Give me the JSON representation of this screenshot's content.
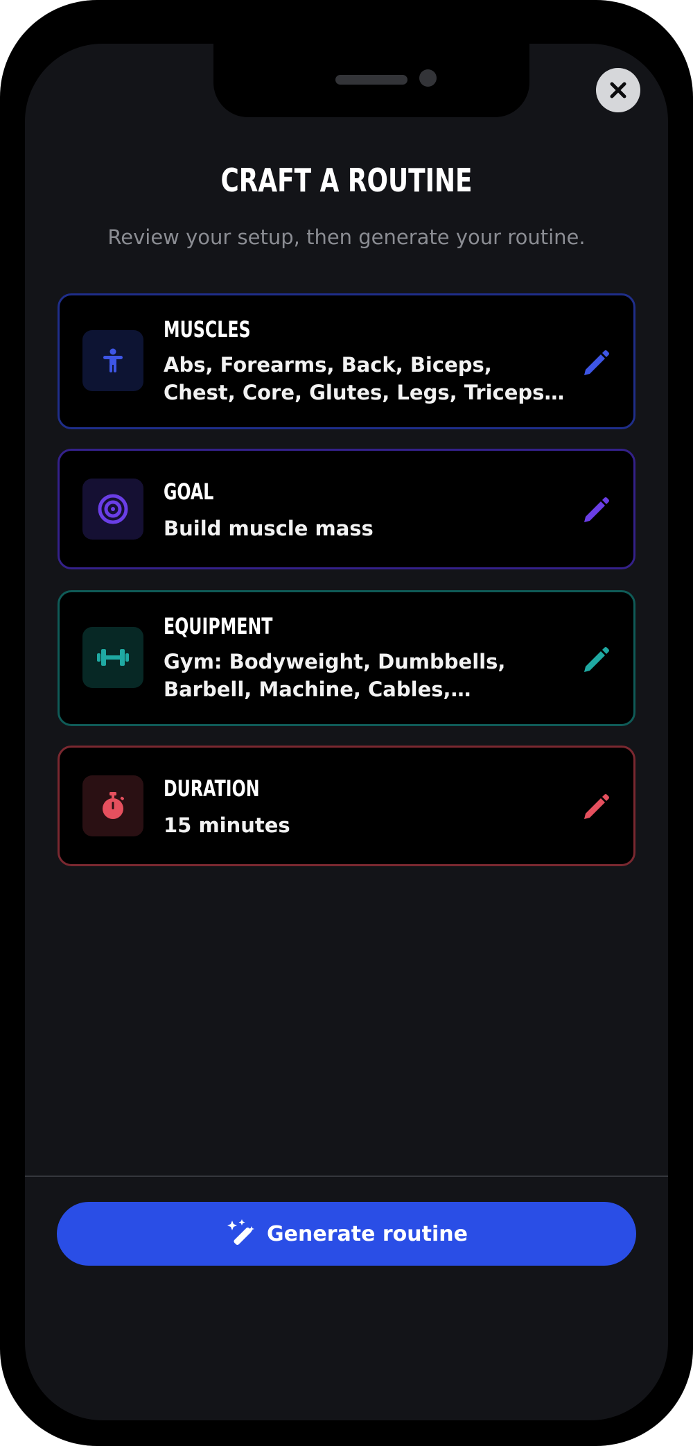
{
  "header": {
    "title": "CRAFT A ROUTINE",
    "subtitle": "Review your setup, then generate your routine."
  },
  "cards": [
    {
      "label": "MUSCLES",
      "value": "Abs, Forearms, Back, Biceps, Chest, Core, Glutes, Legs, Triceps, Shoulders",
      "icon": "body-icon",
      "accent": "#3e56e6"
    },
    {
      "label": "GOAL",
      "value": "Build muscle mass",
      "icon": "target-icon",
      "accent": "#6a3ee6"
    },
    {
      "label": "EQUIPMENT",
      "value": "Gym: Bodyweight, Dumbbells, Barbell, Machine, Cables, Kettlebells",
      "icon": "dumbbell-icon",
      "accent": "#1fa9a2"
    },
    {
      "label": "DURATION",
      "value": "15 minutes",
      "icon": "stopwatch-icon",
      "accent": "#e5505e"
    }
  ],
  "footer": {
    "generate_label": "Generate routine",
    "generate_icon": "magic-wand-icon"
  },
  "colors": {
    "background": "#131418",
    "primary": "#2a4ee6"
  }
}
